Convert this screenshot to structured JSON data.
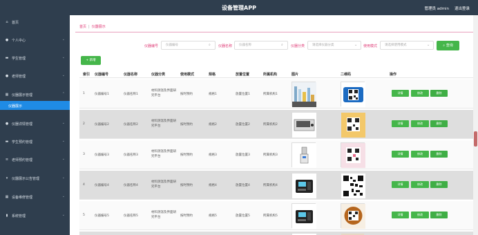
{
  "app": {
    "title": "设备管理APP",
    "user": "管理员 admin",
    "logout": "退出登录"
  },
  "sidebar": {
    "items": [
      {
        "label": "首页",
        "icon": "home-icon"
      },
      {
        "label": "个人中心",
        "icon": "person-icon"
      },
      {
        "label": "学生管理",
        "icon": "list-icon"
      },
      {
        "label": "老师管理",
        "icon": "pin-icon"
      },
      {
        "label": "仪器展示管理",
        "icon": "grid-icon"
      },
      {
        "label": "仪器详情管理",
        "icon": "person-icon"
      },
      {
        "label": "学生预约管理",
        "icon": "chat-icon"
      },
      {
        "label": "老师预约管理",
        "icon": "menu-icon"
      },
      {
        "label": "仪器展示公告管理",
        "icon": "pin-icon"
      },
      {
        "label": "设备维修管理",
        "icon": "grid-icon"
      },
      {
        "label": "系统管理",
        "icon": "chart-icon"
      }
    ],
    "active_sub": "仪器展示"
  },
  "breadcrumb": {
    "home": "首页",
    "separator": "|",
    "current": "仪器展示"
  },
  "filters": [
    {
      "label": "仪器编号",
      "placeholder": "仪器编号"
    },
    {
      "label": "仪器名称",
      "placeholder": "仪器名称"
    },
    {
      "label": "仪器分类",
      "placeholder": "请选择仪器分类"
    },
    {
      "label": "使用模式",
      "placeholder": "请选择使用模式"
    }
  ],
  "search_button": "查询",
  "add_button": "+ 新增",
  "table": {
    "headers": [
      "索引",
      "仪器编号",
      "仪器名称",
      "仪器分类",
      "使用模式",
      "规格",
      "放置位置",
      "所属机构",
      "图片",
      "二维码",
      "操作"
    ],
    "rows": [
      {
        "index": "1",
        "code": "仪器编号1",
        "name": "仪器名称1",
        "category": "材料测温及界面研究平台",
        "mode": "按时预约",
        "spec": "规格1",
        "location": "放置位置1",
        "org": "所属机构1"
      },
      {
        "index": "2",
        "code": "仪器编号2",
        "name": "仪器名称2",
        "category": "材料测温及界面研究平台",
        "mode": "按时预约",
        "spec": "规格2",
        "location": "放置位置2",
        "org": "所属机构2"
      },
      {
        "index": "3",
        "code": "仪器编号3",
        "name": "仪器名称3",
        "category": "材料测温及界面研究平台",
        "mode": "按时预约",
        "spec": "规格3",
        "location": "放置位置3",
        "org": "所属机构3"
      },
      {
        "index": "4",
        "code": "仪器编号4",
        "name": "仪器名称4",
        "category": "材料测温及界面研究平台",
        "mode": "按时预约",
        "spec": "规格4",
        "location": "放置位置4",
        "org": "所属机构4"
      },
      {
        "index": "5",
        "code": "仪器编号5",
        "name": "仪器名称5",
        "category": "材料测温及界面研究平台",
        "mode": "按时预约",
        "spec": "规格5",
        "location": "放置位置5",
        "org": "所属机构5"
      }
    ],
    "actions": {
      "detail": "详情",
      "edit": "修改",
      "delete": "删除"
    }
  },
  "colors": {
    "topbar": "#2f3e4e",
    "sidebar": "#2f3e4e",
    "active": "#1f8be5",
    "accent": "#e0407a",
    "green": "#45b64a"
  }
}
